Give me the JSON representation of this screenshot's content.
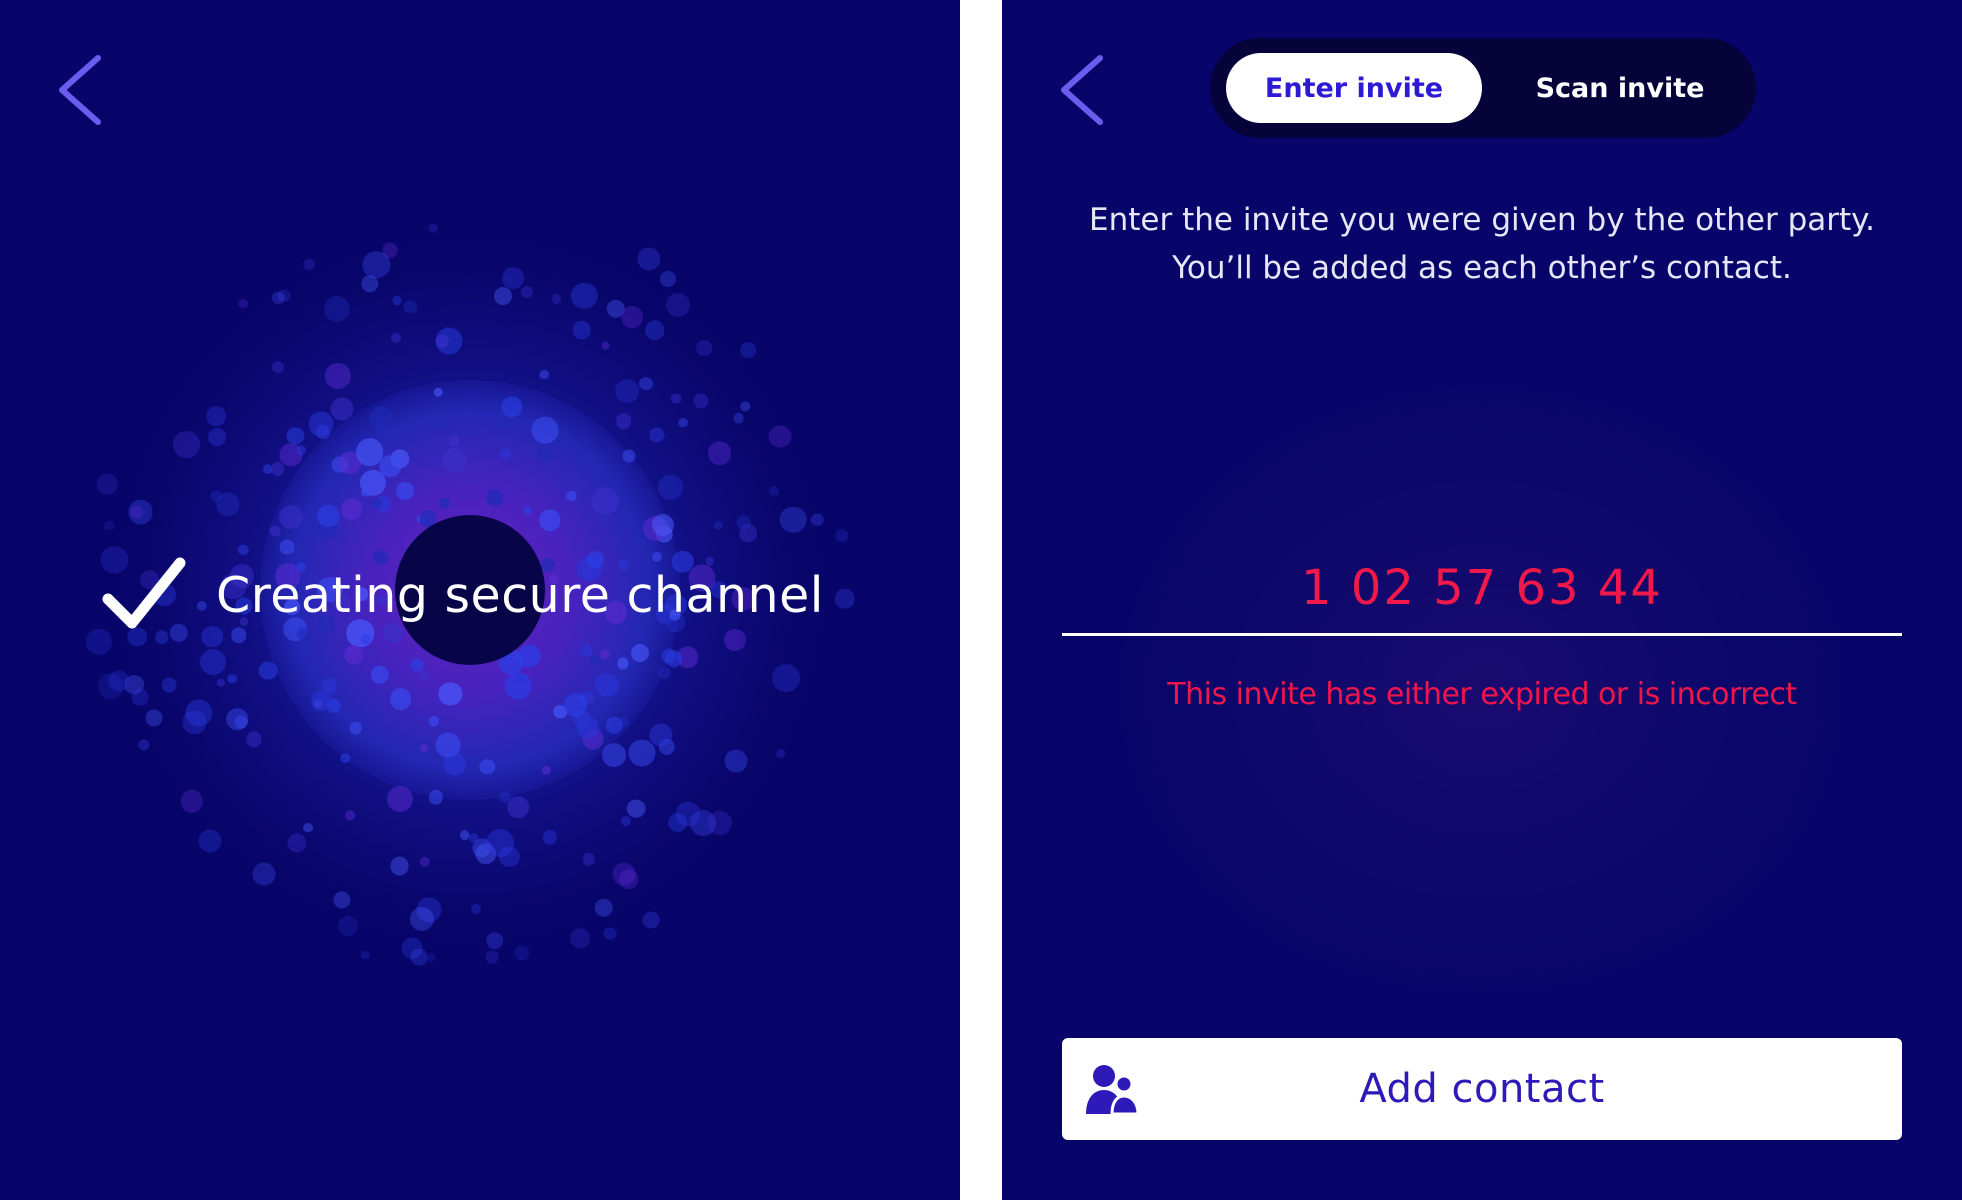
{
  "colors": {
    "background": "#08056a",
    "accent": "#2d1ad4",
    "error": "#f0154a",
    "back_chevron": "#6b5cf0"
  },
  "left_screen": {
    "back_icon": "chevron-left-icon",
    "status": {
      "icon": "checkmark-icon",
      "text": "Creating secure channel"
    }
  },
  "right_screen": {
    "back_icon": "chevron-left-icon",
    "tabs": [
      {
        "label": "Enter invite",
        "selected": true
      },
      {
        "label": "Scan invite",
        "selected": false
      }
    ],
    "instructions": {
      "line1": "Enter the invite you were given by the other party.",
      "line2": "You’ll be added as each other’s contact."
    },
    "invite_input": {
      "value": "1 02 57 63 44"
    },
    "error_message": "This invite has either expired or is incorrect",
    "add_button": {
      "icon": "add-contact-icon",
      "label": "Add contact"
    }
  }
}
